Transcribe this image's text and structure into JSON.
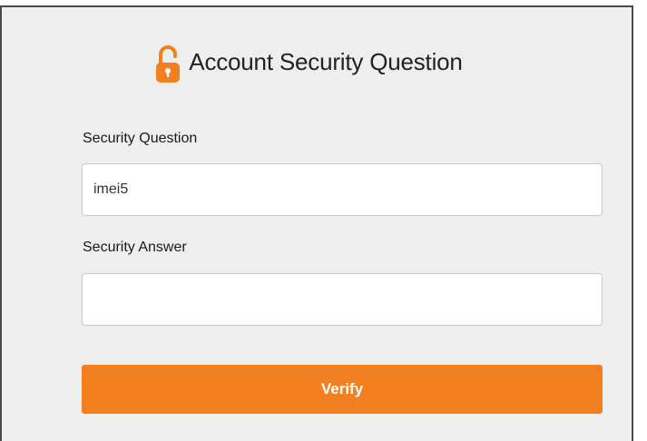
{
  "form": {
    "title": "Account Security Question",
    "question_label": "Security Question",
    "question_value": "imei5",
    "answer_label": "Security Answer",
    "answer_value": "",
    "verify_label": "Verify"
  },
  "icons": {
    "header_icon": "unlocked-padlock-icon"
  },
  "colors": {
    "accent": "#f28021",
    "panel_bg": "#eeeeee"
  }
}
